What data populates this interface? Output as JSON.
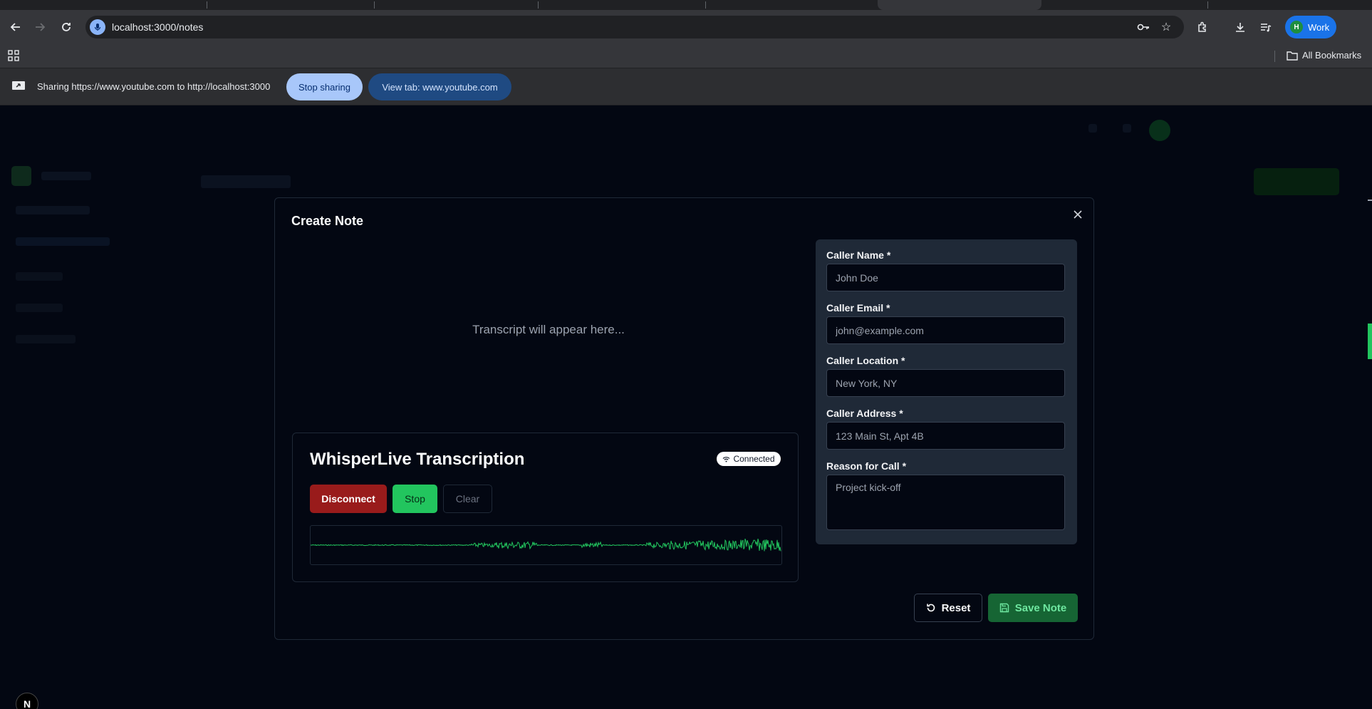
{
  "browser": {
    "url": "localhost:3000/notes",
    "profile_initial": "H",
    "profile_label": "Work",
    "all_bookmarks": "All Bookmarks"
  },
  "sharing_bar": {
    "message": "Sharing https://www.youtube.com to http://localhost:3000",
    "stop_sharing": "Stop sharing",
    "view_tab": "View tab: www.youtube.com"
  },
  "modal": {
    "title": "Create Note",
    "transcript_placeholder": "Transcript will appear here...",
    "whisper": {
      "title": "WhisperLive Transcription",
      "status": "Connected",
      "disconnect": "Disconnect",
      "stop": "Stop",
      "clear": "Clear"
    },
    "form": {
      "caller_name_label": "Caller Name *",
      "caller_name_placeholder": "John Doe",
      "caller_email_label": "Caller Email *",
      "caller_email_placeholder": "john@example.com",
      "caller_location_label": "Caller Location *",
      "caller_location_placeholder": "New York, NY",
      "caller_address_label": "Caller Address *",
      "caller_address_placeholder": "123 Main St, Apt 4B",
      "reason_label": "Reason for Call *",
      "reason_placeholder": "Project kick-off"
    },
    "reset": "Reset",
    "save": "Save Note"
  },
  "colors": {
    "accent_green": "#22c55e",
    "danger_red": "#991b1b",
    "background": "#030712"
  }
}
